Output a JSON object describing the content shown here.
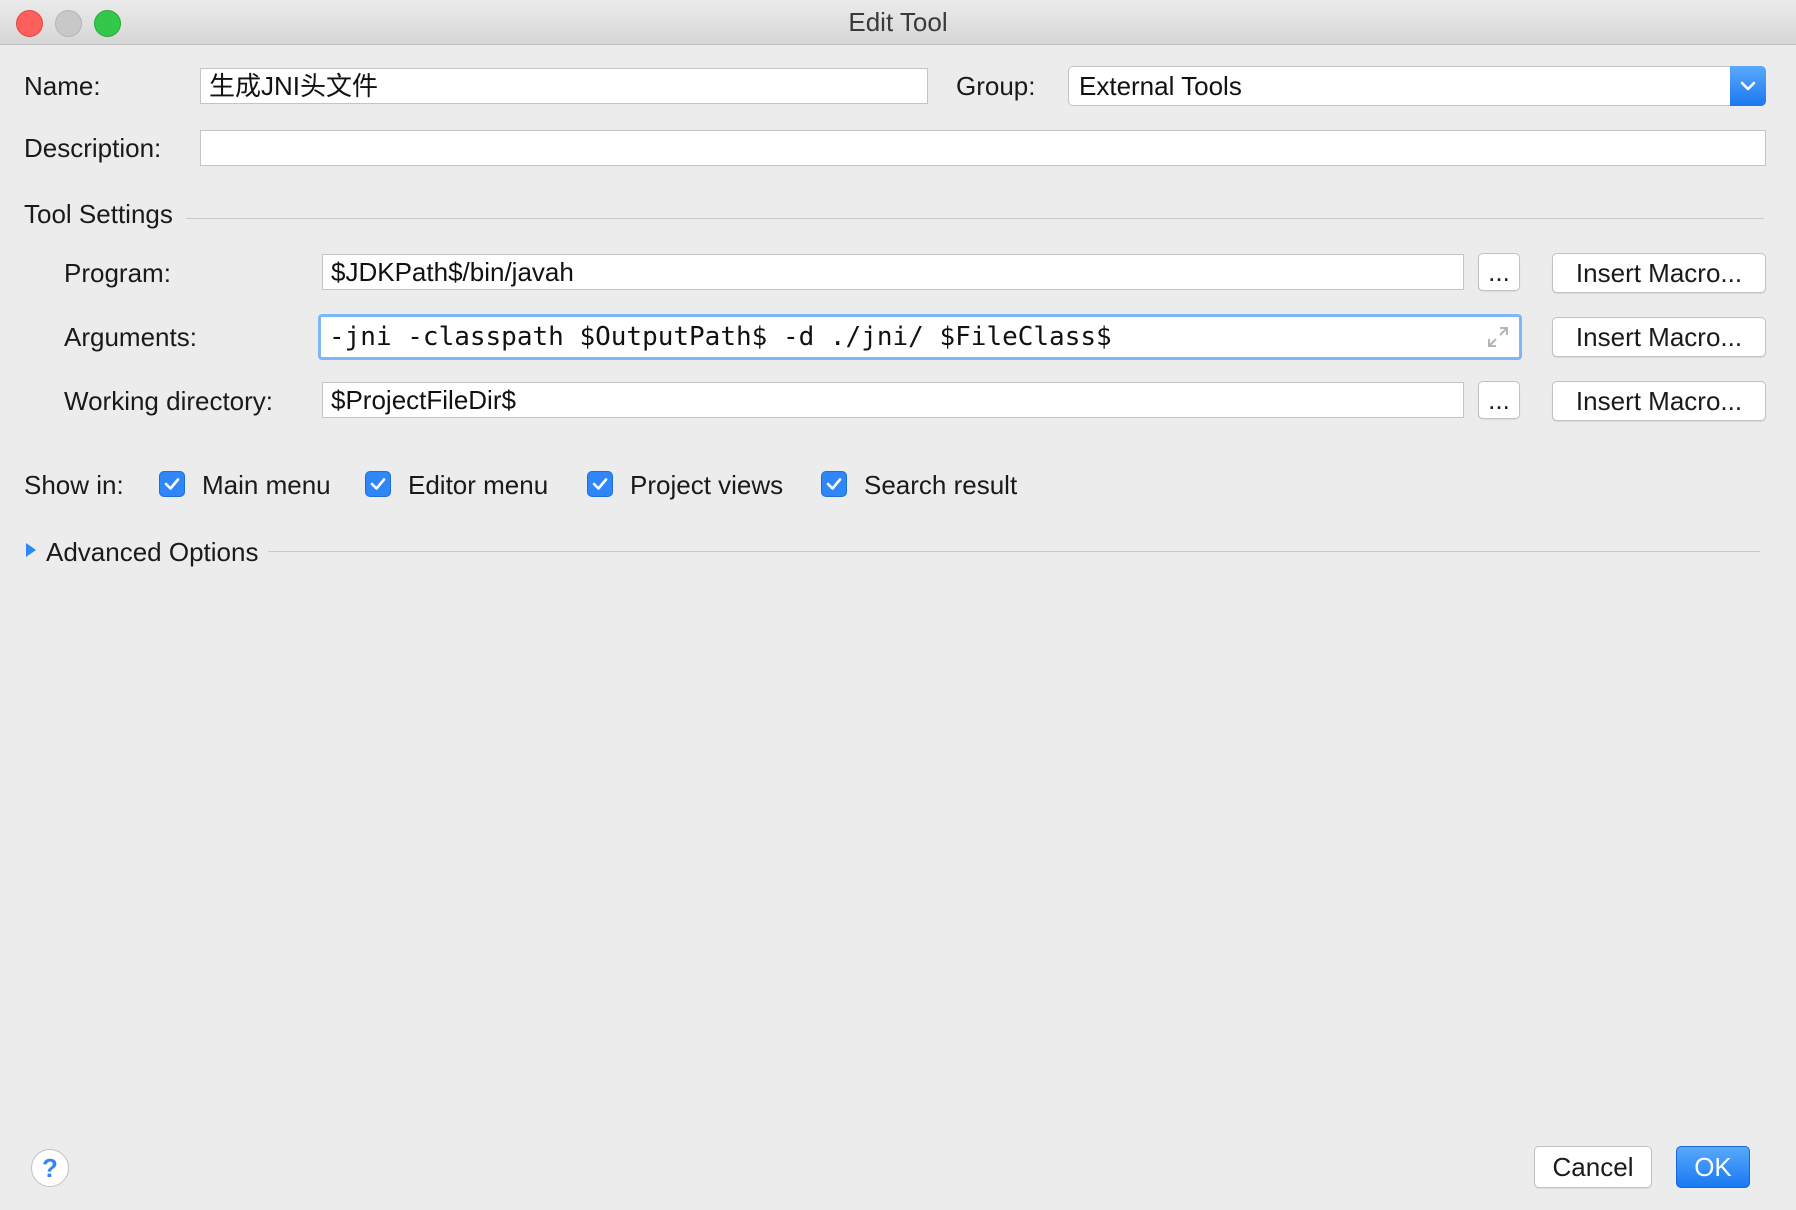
{
  "window": {
    "title": "Edit Tool"
  },
  "form": {
    "name_label": "Name:",
    "name_value": "生成JNI头文件",
    "group_label": "Group:",
    "group_value": "External Tools",
    "description_label": "Description:",
    "description_value": ""
  },
  "tool_settings": {
    "section_label": "Tool Settings",
    "program_label": "Program:",
    "program_value": "$JDKPath$/bin/javah",
    "arguments_label": "Arguments:",
    "arguments_value": "-jni -classpath $OutputPath$ -d ./jni/ $FileClass$",
    "working_dir_label": "Working directory:",
    "working_dir_value": "$ProjectFileDir$",
    "browse_label": "...",
    "insert_macro_label": "Insert Macro..."
  },
  "show_in": {
    "label": "Show in:",
    "options": [
      {
        "label": "Main menu",
        "checked": true
      },
      {
        "label": "Editor menu",
        "checked": true
      },
      {
        "label": "Project views",
        "checked": true
      },
      {
        "label": "Search result",
        "checked": true
      }
    ]
  },
  "advanced": {
    "label": "Advanced Options"
  },
  "footer": {
    "help_label": "?",
    "cancel_label": "Cancel",
    "ok_label": "OK"
  },
  "colors": {
    "accent": "#2f86f6",
    "background": "#ececec",
    "focus_ring": "#7fb6f5"
  }
}
